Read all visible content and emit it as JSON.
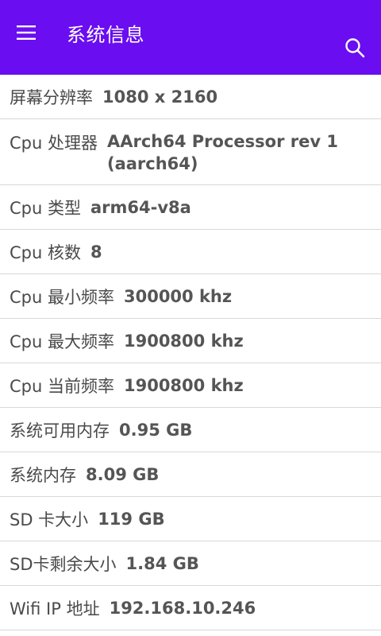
{
  "colors": {
    "appbar": "#6a0df0",
    "divider": "#d8d8d8"
  },
  "header": {
    "menu_icon": "hamburger-menu-icon",
    "title": "系统信息",
    "search_icon": "search-icon"
  },
  "info": [
    {
      "label": "屏幕分辨率",
      "value": "1080 x 2160"
    },
    {
      "label": "Cpu 处理器",
      "value": "AArch64 Processor rev 1 (aarch64)"
    },
    {
      "label": "Cpu 类型",
      "value": "arm64-v8a"
    },
    {
      "label": "Cpu 核数",
      "value": "8"
    },
    {
      "label": "Cpu 最小频率",
      "value": "300000 khz"
    },
    {
      "label": "Cpu 最大频率",
      "value": "1900800 khz"
    },
    {
      "label": "Cpu 当前频率",
      "value": "1900800 khz"
    },
    {
      "label": "系统可用内存",
      "value": "0.95 GB"
    },
    {
      "label": "系统内存",
      "value": "8.09 GB"
    },
    {
      "label": "SD 卡大小",
      "value": "119 GB"
    },
    {
      "label": "SD卡剩余大小",
      "value": "1.84 GB"
    },
    {
      "label": "Wifi IP 地址",
      "value": "192.168.10.246"
    }
  ]
}
